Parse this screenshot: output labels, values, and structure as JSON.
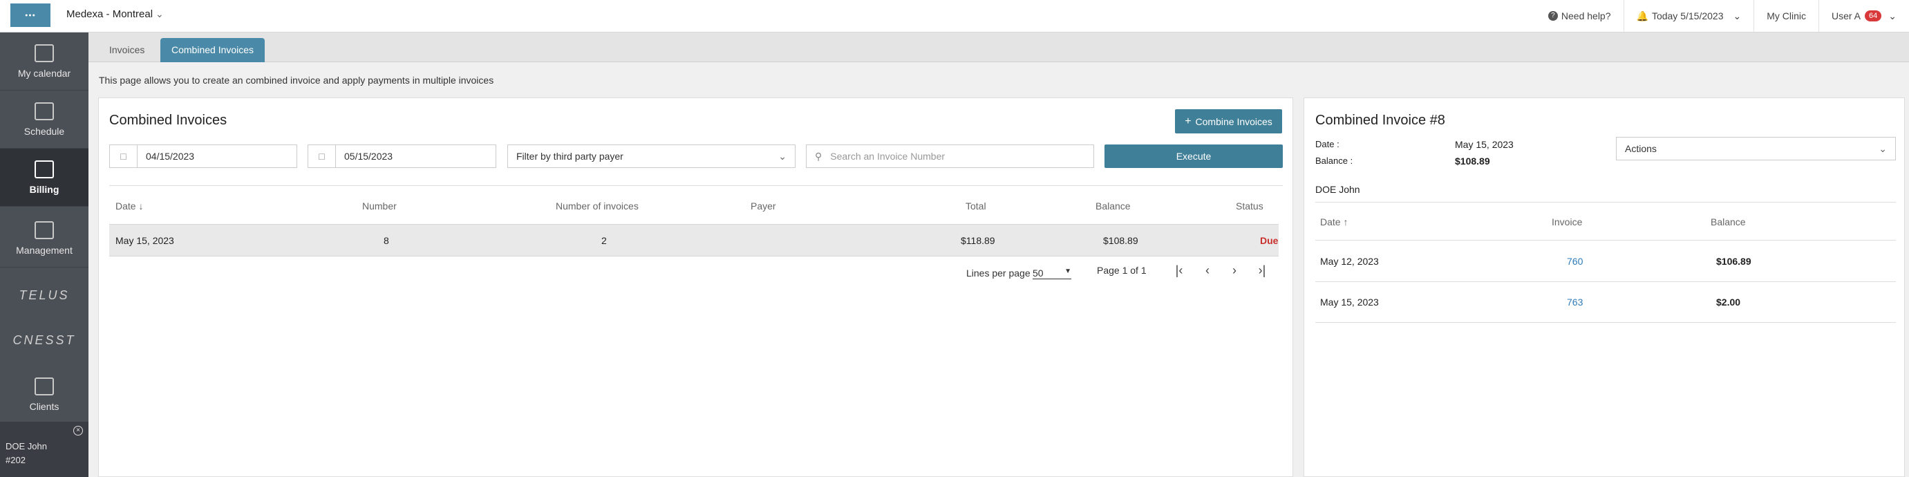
{
  "header": {
    "clinic": "Medexa - Montreal",
    "help": "Need help?",
    "today": "Today 5/15/2023",
    "my_clinic": "My Clinic",
    "user": "User A",
    "notifications": "64"
  },
  "sidebar": {
    "items": [
      {
        "label": "My calendar",
        "icon": "calendar-icon"
      },
      {
        "label": "Schedule",
        "icon": "schedule-icon"
      },
      {
        "label": "Billing",
        "icon": "billing-icon"
      },
      {
        "label": "Management",
        "icon": "chart-icon"
      },
      {
        "label": "Clients",
        "icon": "clients-icon"
      }
    ],
    "logos": [
      "TELUS",
      "CNESST"
    ],
    "patient": {
      "name": "DOE John",
      "number": "#202"
    }
  },
  "tabs": [
    "Invoices",
    "Combined Invoices"
  ],
  "info_text": "This page allows you to create an combined invoice and apply payments in multiple invoices",
  "left_panel": {
    "title": "Combined Invoices",
    "combine_button": "Combine Invoices",
    "date_from": "04/15/2023",
    "date_to": "05/15/2023",
    "payer_filter": "Filter by third party payer",
    "search_placeholder": "Search an Invoice Number",
    "execute_button": "Execute",
    "columns": [
      "Date",
      "Number",
      "Number of invoices",
      "Payer",
      "Total",
      "Balance",
      "Status"
    ],
    "rows": [
      {
        "date": "May 15, 2023",
        "number": "8",
        "count": "2",
        "payer": "",
        "total": "$118.89",
        "balance": "$108.89",
        "status": "Due"
      }
    ],
    "lines_per_page_label": "Lines per page",
    "lines_per_page": "50",
    "page_info": "Page 1 of 1"
  },
  "right_panel": {
    "title": "Combined Invoice #8",
    "date_label": "Date :",
    "date_value": "May 15, 2023",
    "balance_label": "Balance :",
    "balance_value": "$108.89",
    "actions": "Actions",
    "patient": "DOE John",
    "columns": [
      "Date",
      "Invoice",
      "Balance"
    ],
    "rows": [
      {
        "date": "May 12, 2023",
        "invoice": "760",
        "balance": "$106.89"
      },
      {
        "date": "May 15, 2023",
        "invoice": "763",
        "balance": "$2.00"
      }
    ]
  },
  "colors": {
    "accent": "#4a8aa8",
    "due": "#c9302c",
    "sidebar": "#4b4f56"
  }
}
